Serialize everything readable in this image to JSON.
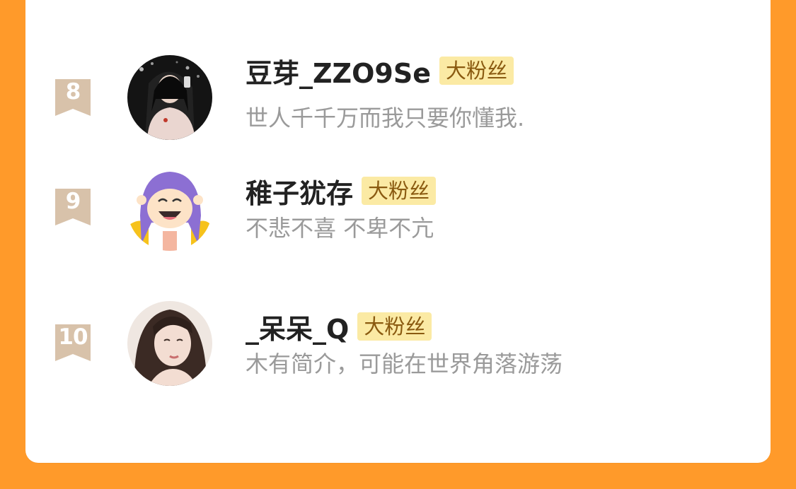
{
  "colors": {
    "background": "#ff9a2a",
    "card": "#ffffff",
    "badge_bg": "#fbeaa4",
    "badge_text": "#8a5a10",
    "rank_ribbon": "#d8c2aa",
    "name_text": "#222222",
    "bio_text": "#9a9a9a"
  },
  "fans": [
    {
      "rank": "8",
      "name": "豆芽_ZZO9Se",
      "badge": "大粉丝",
      "bio": "世人千千万而我只要你懂我.",
      "avatar_icon": "avatar-girl-dark-photo"
    },
    {
      "rank": "9",
      "name": "稚子犹存",
      "badge": "大粉丝",
      "bio": "不悲不喜 不卑不亢",
      "avatar_icon": "avatar-cartoon-girl"
    },
    {
      "rank": "10",
      "name": "_呆呆_Q",
      "badge": "大粉丝",
      "bio": "木有简介，可能在世界角落游荡",
      "avatar_icon": "avatar-girl-portrait"
    }
  ]
}
